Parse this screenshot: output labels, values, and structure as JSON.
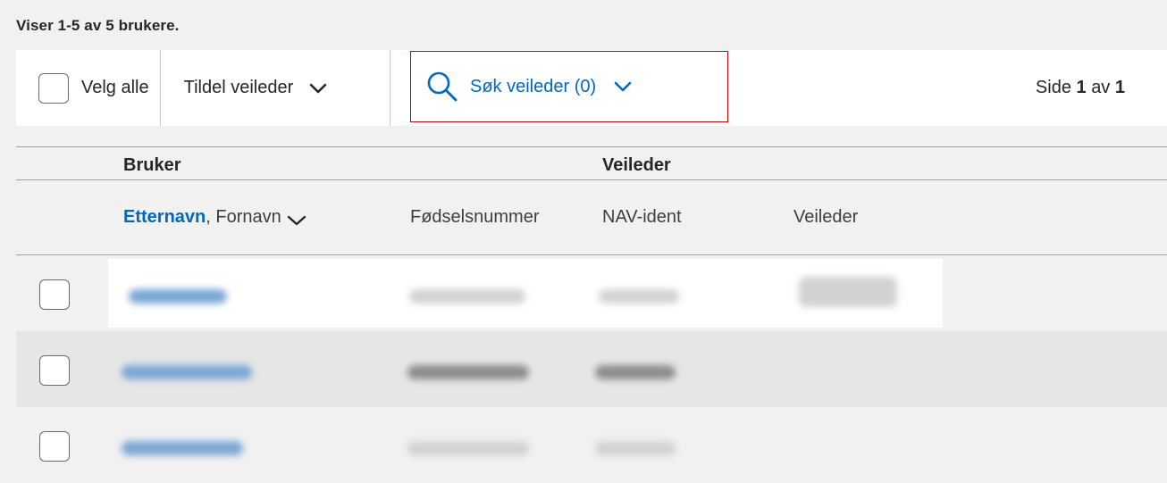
{
  "summary": "Viser 1-5 av 5 brukere.",
  "toolbar": {
    "select_all_label": "Velg alle",
    "assign_label": "Tildel veileder",
    "search_label": "Søk veileder (0)",
    "pager_prefix": "Side",
    "pager_current": "1",
    "pager_mid": "av",
    "pager_total": "1"
  },
  "table": {
    "groups": {
      "bruker": "Bruker",
      "veileder": "Veileder"
    },
    "columns": {
      "name_sort": "Etternavn",
      "name_rest": ", Fornavn",
      "fnr": "Fødselsnummer",
      "navident": "NAV-ident",
      "veileder": "Veileder"
    }
  },
  "colors": {
    "link": "#0067c5",
    "focus_border": "#c30000",
    "row_alt": "#e6e6e6",
    "page_bg": "#f1f1f1"
  },
  "icons": {
    "search": "search-icon",
    "chevron": "chevron-down-icon"
  }
}
